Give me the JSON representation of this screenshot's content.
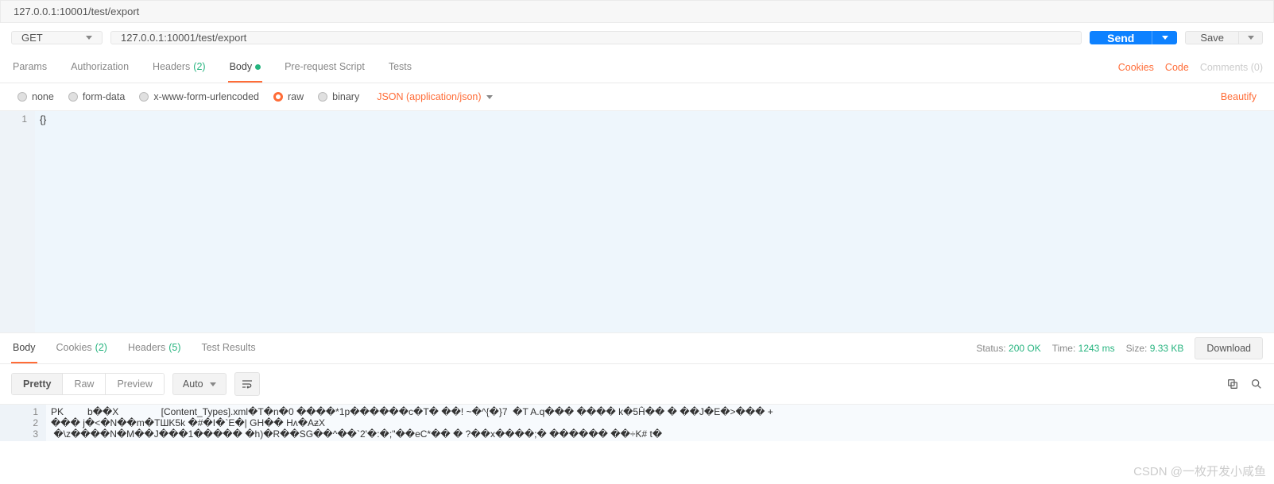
{
  "topUrl": "127.0.0.1:10001/test/export",
  "request": {
    "method": "GET",
    "url": "127.0.0.1:10001/test/export",
    "sendLabel": "Send",
    "saveLabel": "Save"
  },
  "reqTabs": {
    "params": "Params",
    "auth": "Authorization",
    "headers": "Headers",
    "headersCount": "(2)",
    "body": "Body",
    "prereq": "Pre-request Script",
    "tests": "Tests",
    "cookies": "Cookies",
    "code": "Code",
    "comments": "Comments (0)"
  },
  "bodyOpts": {
    "none": "none",
    "formData": "form-data",
    "xwww": "x-www-form-urlencoded",
    "raw": "raw",
    "binary": "binary",
    "contentType": "JSON (application/json)",
    "beautify": "Beautify"
  },
  "reqBody": {
    "lineNum": "1",
    "content": "{}"
  },
  "respTabs": {
    "body": "Body",
    "cookies": "Cookies",
    "cookiesCount": "(2)",
    "headers": "Headers",
    "headersCount": "(5)",
    "testResults": "Test Results"
  },
  "respMeta": {
    "statusLabel": "Status:",
    "statusValue": "200 OK",
    "timeLabel": "Time:",
    "timeValue": "1243 ms",
    "sizeLabel": "Size:",
    "sizeValue": "9.33 KB",
    "download": "Download"
  },
  "respToolbar": {
    "pretty": "Pretty",
    "raw": "Raw",
    "preview": "Preview",
    "auto": "Auto"
  },
  "respBody": {
    "ln1": "1",
    "ln2": "2",
    "ln3": "3",
    "line1": "PK         b��X                [Content_Types].xml�T�n�0 ����*1p������c�T� ��! ~�^{�}7  �T A.q��� ���� k�5Ĥ�� � ��J�E�>��� +",
    "line2": "��� j�<�N��m�TШK5k �#�I�`E�| GH�� Hʌ�AƶX",
    "line3": " �\\z����N�M��J���1����� �h)�R��SG��^��`2'�:�;\"��eC*�� � ?��x����;� ������ ��÷K# t�"
  },
  "watermark": "CSDN @一枚开发小咸鱼"
}
